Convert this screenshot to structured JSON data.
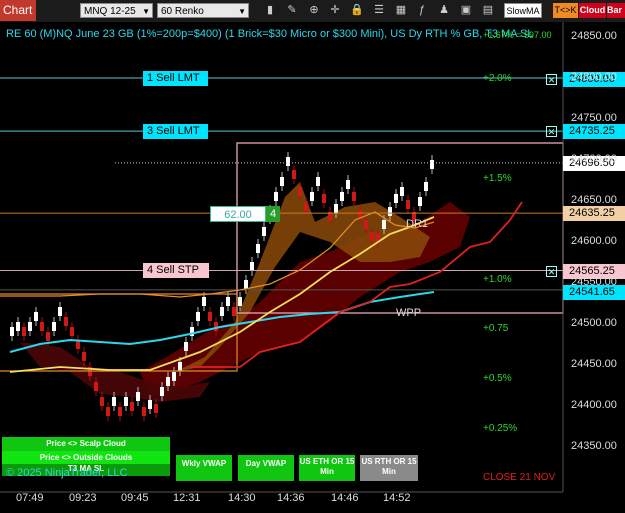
{
  "toolbar": {
    "chart_tab": "Chart",
    "instrument": "MNQ 12-25",
    "bar_type": "60 Renko",
    "slowma": "SlowMA",
    "tk": "T<>K",
    "cloud": "Cloud",
    "bar": "Bar",
    "icons": [
      "bar-style-icon",
      "pencil-icon",
      "zoom-icon",
      "crosshair-icon",
      "lock-icon",
      "properties-icon",
      "grid-icon",
      "indicators-icon",
      "strategies-icon",
      "screenshot-icon",
      "chart-trader-icon"
    ]
  },
  "chart": {
    "header": "RE 60 (M)NQ June 23 GB (1%=200p=$400) (1 Brick=$30 Micro or $300 Mini), US Dy RTH % GB, T3 MA SL",
    "copyright": "© 2025 NinjaTrader, LLC",
    "close_label": "CLOSE 21 NOV",
    "dr1_label": "DR1",
    "wpp_label": "WPP",
    "position_qty": "62.00",
    "position_size": "4",
    "orders": [
      {
        "label": "1 Sell LMT",
        "price": "24800.00"
      },
      {
        "label": "3 Sell LMT",
        "price": "24735.25"
      },
      {
        "label": "4 Sell STP",
        "price": "24565.25"
      }
    ],
    "price_markers": [
      {
        "price": "24696.50",
        "kind": "last"
      },
      {
        "price": "24635.25",
        "kind": "dr1"
      },
      {
        "price": "24541.65",
        "kind": "wpp"
      }
    ],
    "y_ticks": [
      "24850.00",
      "24800.00",
      "24750.00",
      "24700.00",
      "24650.00",
      "24600.00",
      "24550.00",
      "24500.00",
      "24450.00",
      "24400.00",
      "24350.00"
    ],
    "pct_levels": [
      "+2.0%",
      "+1.5%",
      "+1.0%",
      "+0.75",
      "+0.5%",
      "+0.25%"
    ],
    "partial_top_label": "+1.67% = 597.00",
    "x_ticks": [
      "07:49",
      "09:23",
      "09:45",
      "12:31",
      "14:30",
      "14:36",
      "14:46",
      "14:52"
    ],
    "bottom_buttons": {
      "scalp": "Price <> Scalp Cloud",
      "outside": "Price <> Outside Clouds",
      "t3": "T3 MA SL",
      "wkly": "Wkly VWAP",
      "day": "Day VWAP",
      "us_eth": "US ETH OR 15 Min",
      "us_rth": "US RTH OR 15 Min"
    },
    "colors": {
      "accent": "#00e5ff",
      "bull": "#ffffff",
      "bear": "#d01818",
      "cloud_bear": "#6a0000",
      "cloud_bull": "#8a4a08",
      "vwap": "#2ad8ee",
      "ma_yellow": "#f1e05a",
      "ma_red": "#e02020",
      "order_line": "#59c7d6",
      "stop_box": "#f7c6d0"
    }
  }
}
